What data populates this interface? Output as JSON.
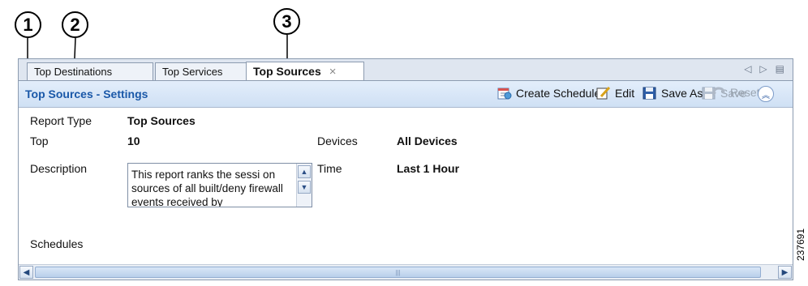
{
  "callouts": [
    "1",
    "2",
    "3"
  ],
  "tabs": [
    {
      "label": "Top Destinations"
    },
    {
      "label": "Top Services"
    },
    {
      "label": "Top Sources",
      "active": true
    }
  ],
  "tab_close": "×",
  "header": {
    "title": "Top Sources - Settings",
    "toolbar": {
      "create_schedule": "Create Schedule",
      "edit": "Edit",
      "save_as": "Save As",
      "save": "Save",
      "reset": "Reset"
    }
  },
  "settings": {
    "report_type_label": "Report Type",
    "report_type_value": "Top Sources",
    "top_label": "Top",
    "top_value": "10",
    "devices_label": "Devices",
    "devices_value": "All Devices",
    "description_label": "Description",
    "description_text": "This report ranks the sessi on sources of all built/deny firewall events received by",
    "time_label": "Time",
    "time_value": "Last 1 Hour",
    "schedules_label": "Schedules"
  },
  "figure_id": "237691",
  "colors": {
    "title": "#1a58a8",
    "header_bg": "#d9e7f7",
    "disabled": "#9aa4b0"
  }
}
